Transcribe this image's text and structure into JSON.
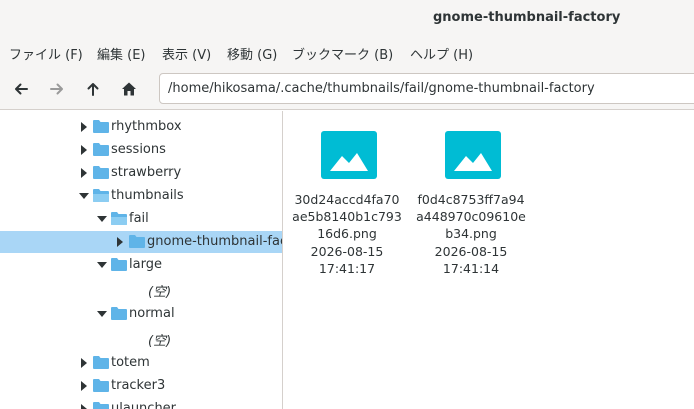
{
  "window": {
    "title": "gnome-thumbnail-factory"
  },
  "menu": [
    {
      "label": "ファイル (F)"
    },
    {
      "label": "編集 (E)"
    },
    {
      "label": "表示 (V)"
    },
    {
      "label": "移動 (G)"
    },
    {
      "label": "ブックマーク (B)"
    },
    {
      "label": "ヘルプ (H)"
    }
  ],
  "toolbar": {
    "back_icon": "arrow-left-icon",
    "forward_icon": "arrow-right-icon",
    "up_icon": "arrow-up-icon",
    "home_icon": "home-icon",
    "location": "/home/hikosama/.cache/thumbnails/fail/gnome-thumbnail-factory"
  },
  "tree": {
    "rhythmbox": "rhythmbox",
    "sessions": "sessions",
    "strawberry": "strawberry",
    "thumbnails": "thumbnails",
    "fail": "fail",
    "gnome_thumbnail_factory": "gnome-thumbnail-factory",
    "large": "large",
    "large_empty": "(空)",
    "normal": "normal",
    "normal_empty": "(空)",
    "totem": "totem",
    "tracker3": "tracker3",
    "ulauncher": "ulauncher"
  },
  "files": [
    {
      "name": "30d24accd4fa70ae5b8140b1c79316d6.png",
      "date": "2026-08-15",
      "time": "17:41:17"
    },
    {
      "name": "f0d4c8753ff7a94a448970c09610eb34.png",
      "date": "2026-08-15",
      "time": "17:41:14"
    }
  ],
  "colors": {
    "folder": "#5fb4e8",
    "image_icon": "#00bcd4",
    "selection": "#a9d6f6"
  }
}
